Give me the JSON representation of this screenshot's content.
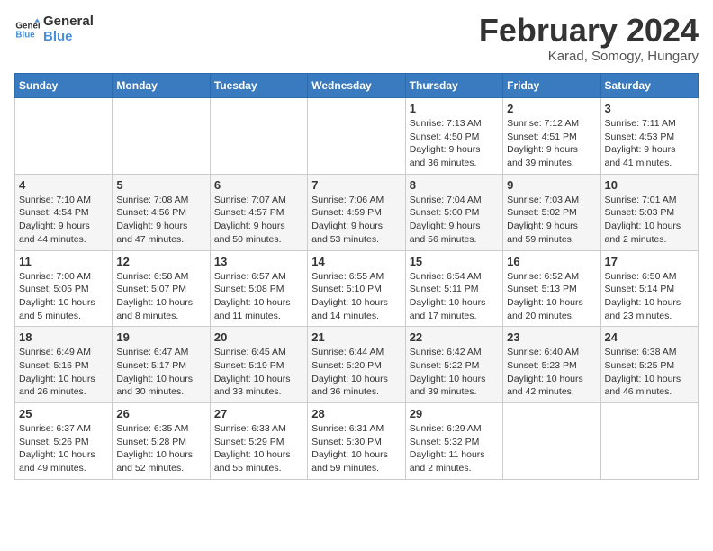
{
  "header": {
    "logo_line1": "General",
    "logo_line2": "Blue",
    "month": "February 2024",
    "location": "Karad, Somogy, Hungary"
  },
  "weekdays": [
    "Sunday",
    "Monday",
    "Tuesday",
    "Wednesday",
    "Thursday",
    "Friday",
    "Saturday"
  ],
  "weeks": [
    [
      {
        "day": "",
        "info": ""
      },
      {
        "day": "",
        "info": ""
      },
      {
        "day": "",
        "info": ""
      },
      {
        "day": "",
        "info": ""
      },
      {
        "day": "1",
        "info": "Sunrise: 7:13 AM\nSunset: 4:50 PM\nDaylight: 9 hours\nand 36 minutes."
      },
      {
        "day": "2",
        "info": "Sunrise: 7:12 AM\nSunset: 4:51 PM\nDaylight: 9 hours\nand 39 minutes."
      },
      {
        "day": "3",
        "info": "Sunrise: 7:11 AM\nSunset: 4:53 PM\nDaylight: 9 hours\nand 41 minutes."
      }
    ],
    [
      {
        "day": "4",
        "info": "Sunrise: 7:10 AM\nSunset: 4:54 PM\nDaylight: 9 hours\nand 44 minutes."
      },
      {
        "day": "5",
        "info": "Sunrise: 7:08 AM\nSunset: 4:56 PM\nDaylight: 9 hours\nand 47 minutes."
      },
      {
        "day": "6",
        "info": "Sunrise: 7:07 AM\nSunset: 4:57 PM\nDaylight: 9 hours\nand 50 minutes."
      },
      {
        "day": "7",
        "info": "Sunrise: 7:06 AM\nSunset: 4:59 PM\nDaylight: 9 hours\nand 53 minutes."
      },
      {
        "day": "8",
        "info": "Sunrise: 7:04 AM\nSunset: 5:00 PM\nDaylight: 9 hours\nand 56 minutes."
      },
      {
        "day": "9",
        "info": "Sunrise: 7:03 AM\nSunset: 5:02 PM\nDaylight: 9 hours\nand 59 minutes."
      },
      {
        "day": "10",
        "info": "Sunrise: 7:01 AM\nSunset: 5:03 PM\nDaylight: 10 hours\nand 2 minutes."
      }
    ],
    [
      {
        "day": "11",
        "info": "Sunrise: 7:00 AM\nSunset: 5:05 PM\nDaylight: 10 hours\nand 5 minutes."
      },
      {
        "day": "12",
        "info": "Sunrise: 6:58 AM\nSunset: 5:07 PM\nDaylight: 10 hours\nand 8 minutes."
      },
      {
        "day": "13",
        "info": "Sunrise: 6:57 AM\nSunset: 5:08 PM\nDaylight: 10 hours\nand 11 minutes."
      },
      {
        "day": "14",
        "info": "Sunrise: 6:55 AM\nSunset: 5:10 PM\nDaylight: 10 hours\nand 14 minutes."
      },
      {
        "day": "15",
        "info": "Sunrise: 6:54 AM\nSunset: 5:11 PM\nDaylight: 10 hours\nand 17 minutes."
      },
      {
        "day": "16",
        "info": "Sunrise: 6:52 AM\nSunset: 5:13 PM\nDaylight: 10 hours\nand 20 minutes."
      },
      {
        "day": "17",
        "info": "Sunrise: 6:50 AM\nSunset: 5:14 PM\nDaylight: 10 hours\nand 23 minutes."
      }
    ],
    [
      {
        "day": "18",
        "info": "Sunrise: 6:49 AM\nSunset: 5:16 PM\nDaylight: 10 hours\nand 26 minutes."
      },
      {
        "day": "19",
        "info": "Sunrise: 6:47 AM\nSunset: 5:17 PM\nDaylight: 10 hours\nand 30 minutes."
      },
      {
        "day": "20",
        "info": "Sunrise: 6:45 AM\nSunset: 5:19 PM\nDaylight: 10 hours\nand 33 minutes."
      },
      {
        "day": "21",
        "info": "Sunrise: 6:44 AM\nSunset: 5:20 PM\nDaylight: 10 hours\nand 36 minutes."
      },
      {
        "day": "22",
        "info": "Sunrise: 6:42 AM\nSunset: 5:22 PM\nDaylight: 10 hours\nand 39 minutes."
      },
      {
        "day": "23",
        "info": "Sunrise: 6:40 AM\nSunset: 5:23 PM\nDaylight: 10 hours\nand 42 minutes."
      },
      {
        "day": "24",
        "info": "Sunrise: 6:38 AM\nSunset: 5:25 PM\nDaylight: 10 hours\nand 46 minutes."
      }
    ],
    [
      {
        "day": "25",
        "info": "Sunrise: 6:37 AM\nSunset: 5:26 PM\nDaylight: 10 hours\nand 49 minutes."
      },
      {
        "day": "26",
        "info": "Sunrise: 6:35 AM\nSunset: 5:28 PM\nDaylight: 10 hours\nand 52 minutes."
      },
      {
        "day": "27",
        "info": "Sunrise: 6:33 AM\nSunset: 5:29 PM\nDaylight: 10 hours\nand 55 minutes."
      },
      {
        "day": "28",
        "info": "Sunrise: 6:31 AM\nSunset: 5:30 PM\nDaylight: 10 hours\nand 59 minutes."
      },
      {
        "day": "29",
        "info": "Sunrise: 6:29 AM\nSunset: 5:32 PM\nDaylight: 11 hours\nand 2 minutes."
      },
      {
        "day": "",
        "info": ""
      },
      {
        "day": "",
        "info": ""
      }
    ]
  ]
}
